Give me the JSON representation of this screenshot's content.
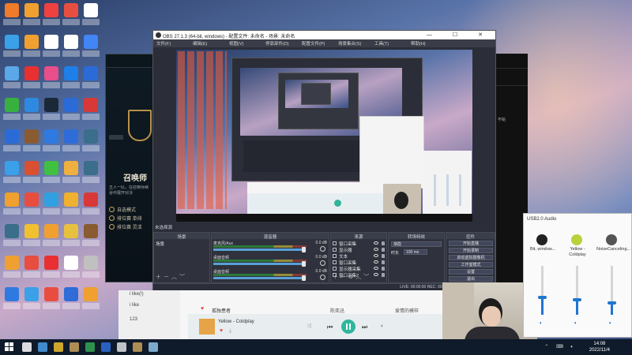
{
  "obs": {
    "title": "OBS 27.1.3 (64-bit, windows) - 配置文件: 未命名 - 场景: 未命名",
    "menu": [
      "文件(F)",
      "编辑(E)",
      "视图(V)",
      "停靠部件(D)",
      "配置文件(P)",
      "场景集合(S)",
      "工具(T)",
      "帮助(H)"
    ],
    "source_label": "未选择源",
    "docks": {
      "scenes": "场景",
      "sources": "来源",
      "mixer": "混音器",
      "transitions": "转场特效",
      "controls": "控件"
    },
    "scene_items": [
      "场景"
    ],
    "mixer_rows": [
      {
        "name": "麦克风/Aux",
        "db": "0.0 dB",
        "level": 0.97
      },
      {
        "name": "桌面音频",
        "db": "0.0 dB",
        "level": 0.97
      },
      {
        "name": "桌面音频",
        "db": "0.0 dB",
        "level": 0.97
      }
    ],
    "sources": [
      "窗口采集",
      "显示器",
      "文本",
      "窗口采集",
      "显示器采集",
      "窗口采集2"
    ],
    "transition": {
      "selected": "渐隐",
      "duration_label": "时长",
      "duration": "100 ms"
    },
    "controls": [
      "开始直播",
      "开始录制",
      "启动虚拟摄像机",
      "工作室模式",
      "设置",
      "退出"
    ],
    "status": "LIVE: 00:00:00   REC: 00:00:00   CPU: 1.5%, 60.00 fps",
    "window_buttons": "— ☐ ✕"
  },
  "league": {
    "title": "召唤师",
    "desc": "五人一队，在召唤师峡谷中展开对决",
    "modes": [
      "自选模式",
      "排位赛 单排",
      "排位赛 灵活"
    ]
  },
  "right_panel": {
    "text": "不始"
  },
  "music": {
    "playlists": [
      "i like(!)",
      "i like",
      "123"
    ],
    "track": {
      "title": "孤独患者",
      "artist": "陈奕迅",
      "album": "爱情的模样"
    },
    "now_playing": "Yellow - Coldplay"
  },
  "audio_mixer": {
    "title": "USB2.0 Audio",
    "apps": [
      {
        "name": "Bit, window...",
        "color": "#222222",
        "level": 0.35,
        "volume_icon": "speaker-icon"
      },
      {
        "name": "Yellow - Coldplay",
        "color": "#b9d13a",
        "level": 0.3,
        "volume_icon": "speaker-icon"
      },
      {
        "name": "NoiseCanceling...",
        "color": "#555555",
        "level": 0.25,
        "volume_icon": "speaker-icon"
      }
    ]
  },
  "taskbar": {
    "time": "14:08",
    "date": "2022/11/4",
    "icons": [
      "#ffffff",
      "#4a9fe8",
      "#f2c12e",
      "#c9a25a",
      "#34a853",
      "#2f6fd8",
      "#e0e0e0",
      "#c9a25a",
      "#8fc4ea"
    ]
  },
  "desktop_icons": [
    "#f07b2a",
    "#f0a030",
    "#f04040",
    "#e84e40",
    "#ffffff",
    "#3aa0e8",
    "#f0a030",
    "#ffffff",
    "#ffffff",
    "#4285f4",
    "#5aa8e8",
    "#e83030",
    "#e84e8a",
    "#1e7fe8",
    "#2b6bd8",
    "#38b040",
    "#2e8ae0",
    "#1b2838",
    "#2b6bd8",
    "#d83838",
    "#2b6bd8",
    "#8a5a30",
    "#2e7ae0",
    "#2e6cd8",
    "#3a6e8a",
    "#3aa0e8",
    "#d85030",
    "#40c040",
    "#f0b040",
    "#3a6e8a",
    "#f0a030",
    "#e84e40",
    "#30a0e0",
    "#f0b030",
    "#d83838",
    "#3a6e8a",
    "#f0c030",
    "#f0a030",
    "#e8c040",
    "#8a5a30",
    "#f0a030",
    "#e84e40",
    "#e83030",
    "#ffffff",
    "#c0c0c0",
    "#2e7ae0",
    "#3aa0e8",
    "#e84e40",
    "#2e6cd8",
    "#f0a030"
  ]
}
